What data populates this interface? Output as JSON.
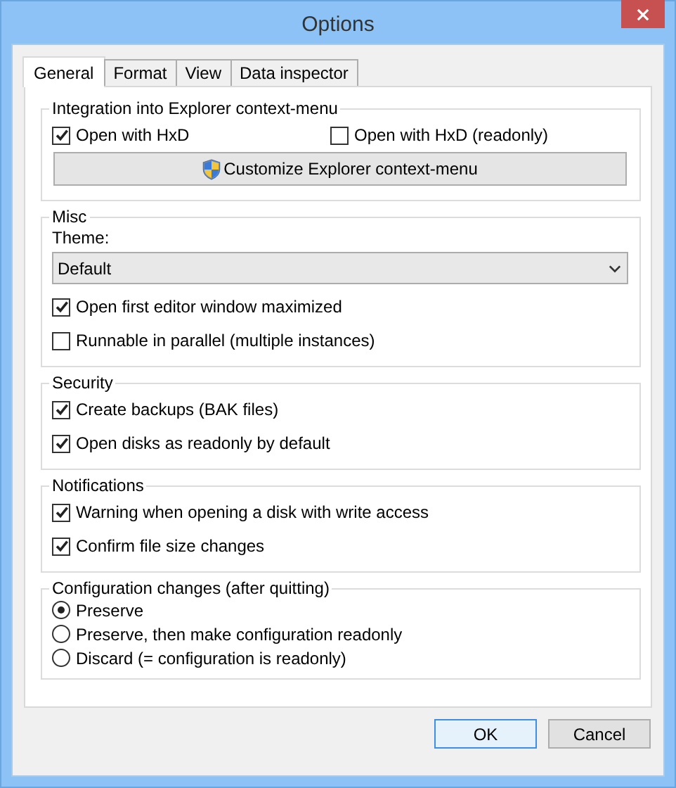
{
  "window": {
    "title": "Options"
  },
  "tabs": [
    {
      "label": "General",
      "selected": true
    },
    {
      "label": "Format",
      "selected": false
    },
    {
      "label": "View",
      "selected": false
    },
    {
      "label": "Data inspector",
      "selected": false
    }
  ],
  "groups": [
    {
      "title": "Integration into Explorer context-menu",
      "items": [
        {
          "kind": "checkbox_row",
          "items": [
            {
              "label": "Open with HxD",
              "checked": true
            },
            {
              "label": "Open with HxD (readonly)",
              "checked": false
            }
          ]
        },
        {
          "kind": "button",
          "label": "Customize Explorer context-menu"
        }
      ]
    },
    {
      "title": "Misc",
      "items": [
        {
          "kind": "label",
          "label": "Theme:"
        },
        {
          "kind": "dropdown",
          "value": "Default"
        },
        {
          "kind": "checkbox",
          "label": "Open first editor window maximized",
          "checked": true
        },
        {
          "kind": "checkbox",
          "label": "Runnable in parallel (multiple instances)",
          "checked": false
        }
      ]
    },
    {
      "title": "Security",
      "items": [
        {
          "kind": "checkbox",
          "label": "Create backups (BAK files)",
          "checked": true
        },
        {
          "kind": "checkbox",
          "label": "Open disks as readonly by default",
          "checked": true
        }
      ]
    },
    {
      "title": "Notifications",
      "items": [
        {
          "kind": "checkbox",
          "label": "Warning when opening a disk with write access",
          "checked": true
        },
        {
          "kind": "checkbox",
          "label": "Confirm file size changes",
          "checked": true
        }
      ]
    },
    {
      "title": "Configuration changes (after quitting)",
      "items": [
        {
          "kind": "radio",
          "label": "Preserve",
          "selected": true
        },
        {
          "kind": "radio",
          "label": "Preserve, then make configuration readonly",
          "selected": false
        },
        {
          "kind": "radio",
          "label": "Discard (= configuration is readonly)",
          "selected": false
        }
      ]
    }
  ],
  "buttons": [
    {
      "label": "OK",
      "default": true
    },
    {
      "label": "Cancel",
      "default": false
    }
  ]
}
